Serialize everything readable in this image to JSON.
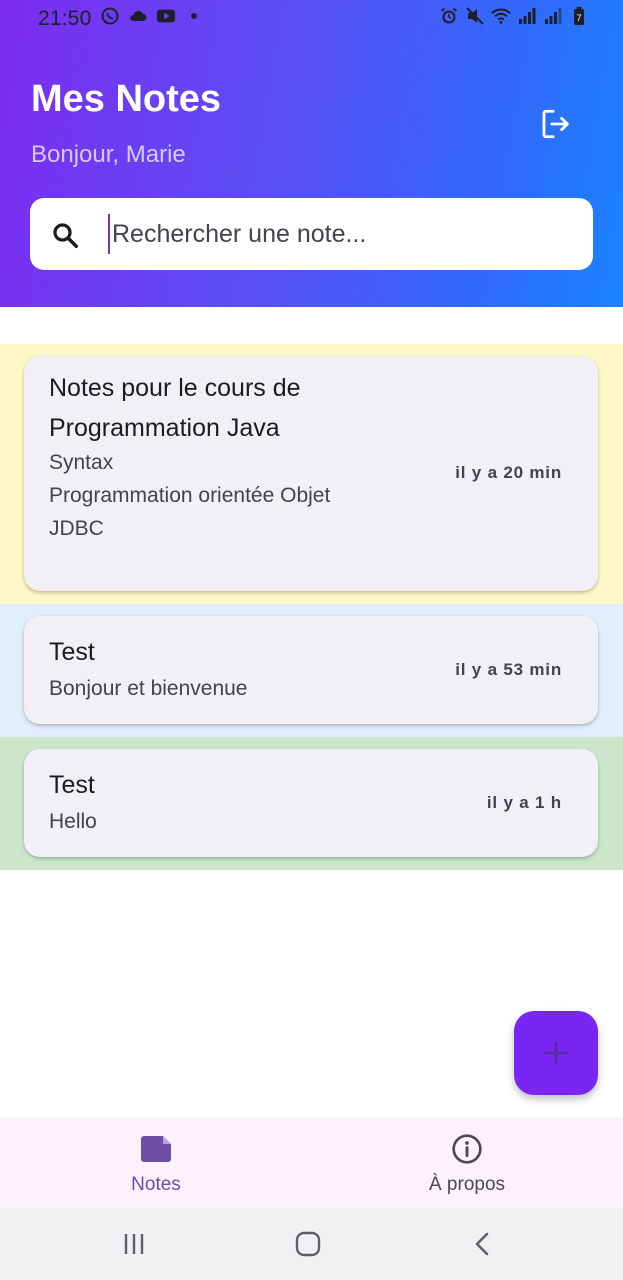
{
  "status_bar": {
    "time": "21:50",
    "left_icons": [
      "whatsapp-icon",
      "cloud-icon",
      "youtube-icon",
      "dot-icon"
    ],
    "right_icons": [
      "alarm-icon",
      "mute-icon",
      "wifi-icon",
      "signal-icon",
      "signal-icon",
      "battery-icon"
    ],
    "battery_level": "7"
  },
  "header": {
    "title": "Mes Notes",
    "greeting": "Bonjour, Marie",
    "logout_icon": "logout-icon"
  },
  "search": {
    "placeholder": "Rechercher une note...",
    "value": ""
  },
  "notes": [
    {
      "title": "Notes pour le cours de Programmation Java",
      "body": "Syntax\nProgrammation orientée Objet\nJDBC",
      "time": "il y a 20 min",
      "band_color": "#fff7c5"
    },
    {
      "title": "Test",
      "body": "Bonjour et bienvenue",
      "time": "il y a 53 min",
      "band_color": "#e1eefb"
    },
    {
      "title": "Test",
      "body": "Hello",
      "time": "il y a 1 h",
      "band_color": "#cce6cc"
    }
  ],
  "fab": {
    "icon": "plus-icon"
  },
  "bottom_nav": {
    "items": [
      {
        "label": "Notes",
        "icon": "note-icon",
        "selected": true
      },
      {
        "label": "À propos",
        "icon": "info-icon",
        "selected": false
      }
    ]
  },
  "colors": {
    "header_gradient_start": "#7d2cf0",
    "header_gradient_end": "#1a84fe",
    "accent": "#7a26f2",
    "nav_selected": "#6f4ea6",
    "nav_unselected": "#4d4a55",
    "card_bg": "#f3eff6"
  }
}
